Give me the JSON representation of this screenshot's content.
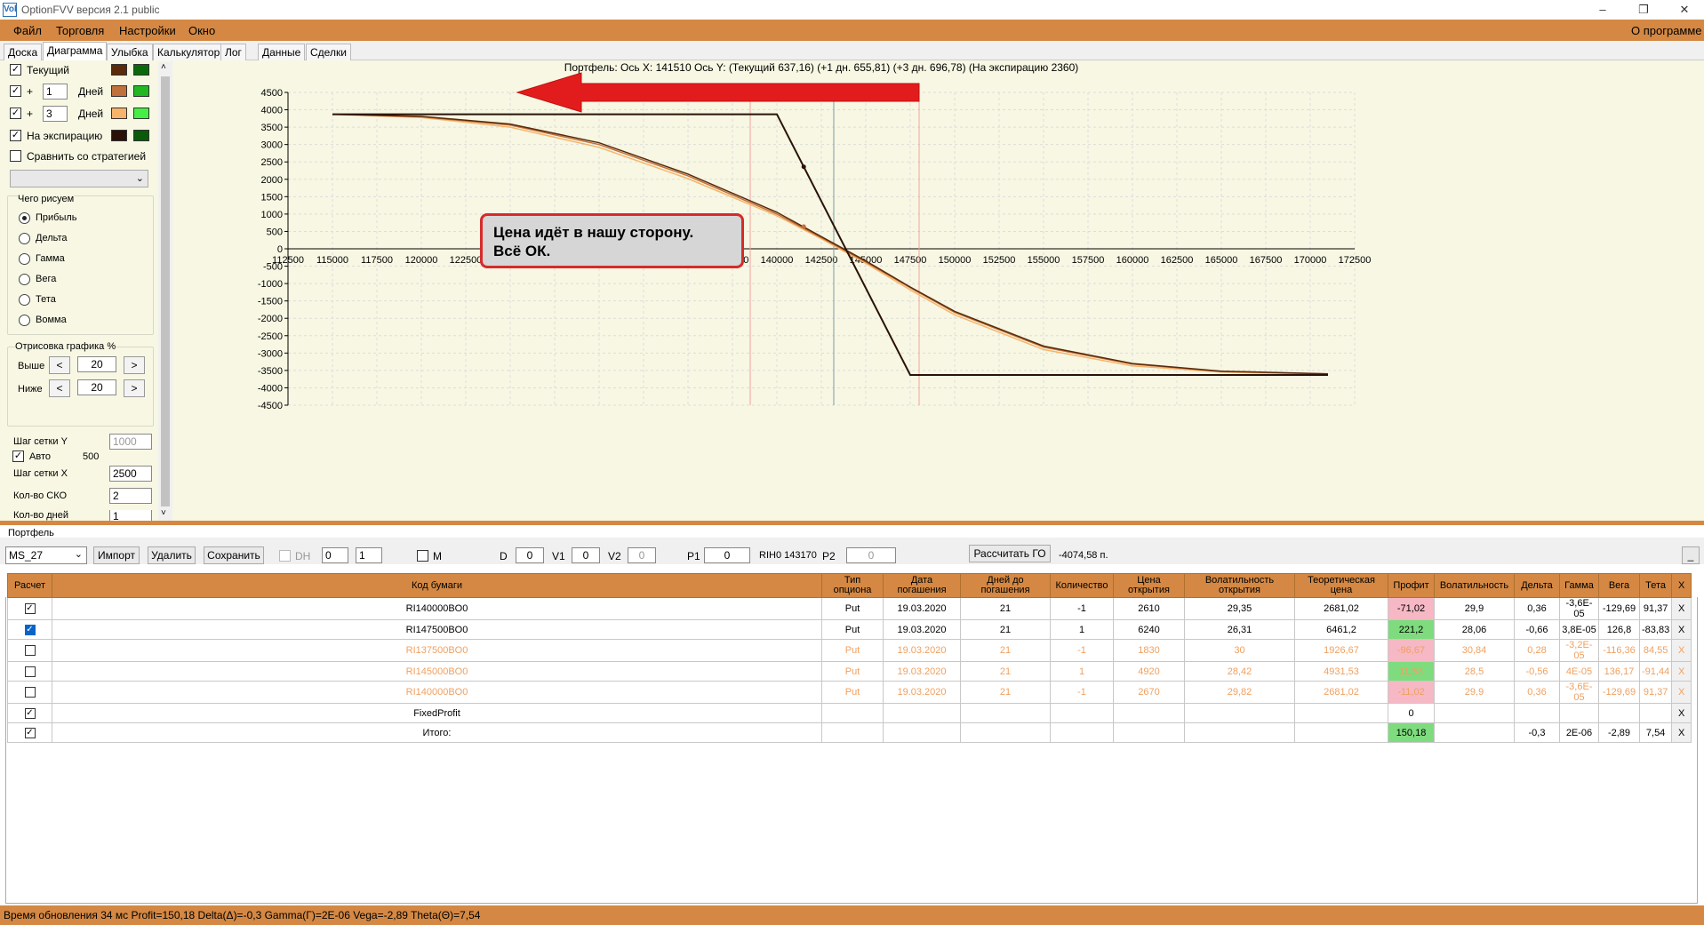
{
  "window": {
    "title": "OptionFVV версия 2.1 public",
    "minimize": "–",
    "restore": "❐",
    "close": "✕"
  },
  "menu": {
    "items": [
      "Файл",
      "Торговля",
      "Настройки",
      "Окно"
    ],
    "about": "О программе"
  },
  "tabs": [
    "Доска",
    "Диаграмма",
    "Улыбка",
    "Калькулятор",
    "Лог",
    "Данные",
    "Сделки"
  ],
  "left": {
    "current_label": "Текущий",
    "plus": "+",
    "days1": "1",
    "days_label": "Дней",
    "days2": "3",
    "expiry_label": "На экспирацию",
    "compare_label": "Сравнить со стратегией",
    "draw_group": "Чего рисуем",
    "draw_options": [
      "Прибыль",
      "Дельта",
      "Гамма",
      "Вега",
      "Тета",
      "Вомма"
    ],
    "render_group": "Отрисовка графика %",
    "above_label": "Выше",
    "above_val": "20",
    "below_label": "Ниже",
    "below_val": "20",
    "prev": "<",
    "next": ">",
    "grid_y_label": "Шаг сетки Y",
    "grid_y_val": "1000",
    "auto_label": "Авто",
    "auto_val": "500",
    "grid_x_label": "Шаг сетки X",
    "grid_x_val": "2500",
    "sko_label": "Кол-во СКО",
    "sko_val": "2",
    "days_count_label": "Кол-во дней",
    "days_count_val": "1",
    "colors": {
      "current": [
        "#5a2a0a",
        "#0a6a0a"
      ],
      "plus1": [
        "#c0703a",
        "#22b822"
      ],
      "plus3": [
        "#f8b46a",
        "#44ee44"
      ],
      "expiry": [
        "#2a1208",
        "#0a5a0a"
      ]
    }
  },
  "chart_data": {
    "type": "line",
    "title": "Портфель: Ось X: 141510 Ось Y:  (Текущий 637,16)  (+1 дн. 655,81)  (+3 дн. 696,78)  (На экспирацию 2360)",
    "xlim": [
      112500,
      172500
    ],
    "ylim": [
      -4500,
      4500
    ],
    "x_ticks": [
      "112500",
      "115000",
      "117500",
      "120000",
      "122500",
      "125000",
      "127500",
      "130000",
      "132500",
      "135000",
      "137500",
      "140000",
      "142500",
      "145000",
      "147500",
      "150000",
      "152500",
      "155000",
      "157500",
      "160000",
      "162500",
      "165000",
      "167500",
      "170000",
      "172500"
    ],
    "y_ticks": [
      "4500",
      "4000",
      "3500",
      "3000",
      "2500",
      "2000",
      "1500",
      "1000",
      "500",
      "0",
      "-500",
      "-1000",
      "-1500",
      "-2000",
      "-2500",
      "-3000",
      "-3500",
      "-4000",
      "-4500"
    ],
    "markers": {
      "current_x": 143200,
      "sko_lines": [
        138500,
        148000
      ]
    },
    "series": [
      {
        "color": "#2a1208",
        "points": [
          [
            115000,
            3870
          ],
          [
            140000,
            3870
          ],
          [
            147500,
            -3630
          ],
          [
            171000,
            -3630
          ]
        ]
      },
      {
        "color": "#5a2a0a",
        "points": [
          [
            115000,
            3870
          ],
          [
            120000,
            3810
          ],
          [
            125000,
            3590
          ],
          [
            130000,
            3050
          ],
          [
            135000,
            2150
          ],
          [
            140000,
            1050
          ],
          [
            142500,
            350
          ],
          [
            145000,
            -350
          ],
          [
            147500,
            -1100
          ],
          [
            150000,
            -1800
          ],
          [
            155000,
            -2800
          ],
          [
            160000,
            -3300
          ],
          [
            165000,
            -3520
          ],
          [
            171000,
            -3600
          ]
        ]
      },
      {
        "color": "#c0703a",
        "points": [
          [
            115000,
            3870
          ],
          [
            120000,
            3800
          ],
          [
            125000,
            3560
          ],
          [
            130000,
            3000
          ],
          [
            135000,
            2100
          ],
          [
            140000,
            1000
          ],
          [
            142500,
            320
          ],
          [
            145000,
            -380
          ],
          [
            147500,
            -1120
          ],
          [
            150000,
            -1830
          ],
          [
            155000,
            -2830
          ],
          [
            160000,
            -3320
          ],
          [
            165000,
            -3530
          ],
          [
            171000,
            -3600
          ]
        ]
      },
      {
        "color": "#f8b46a",
        "points": [
          [
            115000,
            3870
          ],
          [
            120000,
            3780
          ],
          [
            125000,
            3500
          ],
          [
            130000,
            2920
          ],
          [
            135000,
            2020
          ],
          [
            140000,
            950
          ],
          [
            142500,
            290
          ],
          [
            145000,
            -420
          ],
          [
            147500,
            -1180
          ],
          [
            150000,
            -1900
          ],
          [
            155000,
            -2900
          ],
          [
            160000,
            -3370
          ],
          [
            165000,
            -3550
          ],
          [
            171000,
            -3610
          ]
        ]
      }
    ]
  },
  "callout": {
    "line1": "Цена идёт в нашу сторону.",
    "line2": "Всё ОК."
  },
  "portfolio": {
    "label": "Портфель",
    "account": "MS_27",
    "import": "Импорт",
    "delete": "Удалить",
    "save": "Сохранить",
    "dh": "DH",
    "dh_a": "0",
    "dh_b": "1",
    "m": "M",
    "d_label": "D",
    "d_val": "0",
    "v1_label": "V1",
    "v1_val": "0",
    "v2_label": "V2",
    "v2_val": "0",
    "p1_label": "P1",
    "p1_val": "0",
    "ri_info": "RIH0 143170",
    "p2_label": "P2",
    "p2_val": "0",
    "calc_go": "Рассчитать ГО",
    "go_value": "-4074,58 п.",
    "minimize": "_"
  },
  "table": {
    "headers": [
      "Расчет",
      "Код бумаги",
      "Тип опциона",
      "Дата погашения",
      "Дней до погашения",
      "Количество",
      "Цена открытия",
      "Волатильность открытия",
      "Теоретическая цена",
      "Профит",
      "Волатильность",
      "Дельта",
      "Гамма",
      "Вега",
      "Тета",
      "X"
    ],
    "rows": [
      {
        "checked": true,
        "cells": [
          "RI140000BO0",
          "Put",
          "19.03.2020",
          "21",
          "-1",
          "2610",
          "29,35",
          "2681,02",
          "-71,02",
          "29,9",
          "0,36",
          "-3,6E-05",
          "-129,69",
          "91,37",
          "X"
        ],
        "profit_bg": "pink"
      },
      {
        "checked": true,
        "sel": true,
        "cells": [
          "RI147500BO0",
          "Put",
          "19.03.2020",
          "21",
          "1",
          "6240",
          "26,31",
          "6461,2",
          "221,2",
          "28,06",
          "-0,66",
          "3,8E-05",
          "126,8",
          "-83,83",
          "X"
        ],
        "profit_bg": "green"
      },
      {
        "checked": false,
        "dis": true,
        "cells": [
          "RI137500BO0",
          "Put",
          "19.03.2020",
          "21",
          "-1",
          "1830",
          "30",
          "1926,67",
          "-96,67",
          "30,84",
          "0,28",
          "-3,2E-05",
          "-116,36",
          "84,55",
          "X"
        ],
        "profit_bg": "pink"
      },
      {
        "checked": false,
        "dis": true,
        "cells": [
          "RI145000BO0",
          "Put",
          "19.03.2020",
          "21",
          "1",
          "4920",
          "28,42",
          "4931,53",
          "11,53",
          "28,5",
          "-0,56",
          "4E-05",
          "136,17",
          "-91,44",
          "X"
        ],
        "profit_bg": "green"
      },
      {
        "checked": false,
        "dis": true,
        "cells": [
          "RI140000BO0",
          "Put",
          "19.03.2020",
          "21",
          "-1",
          "2670",
          "29,82",
          "2681,02",
          "-11,02",
          "29,9",
          "0,36",
          "-3,6E-05",
          "-129,69",
          "91,37",
          "X"
        ],
        "profit_bg": "pink"
      },
      {
        "checked": true,
        "cells": [
          "FixedProfit",
          "",
          "",
          "",
          "",
          "",
          "",
          "",
          "0",
          "",
          "",
          "",
          "",
          "",
          "X"
        ],
        "profit_bg": ""
      },
      {
        "checked": true,
        "cells": [
          "Итого:",
          "",
          "",
          "",
          "",
          "",
          "",
          "",
          "150,18",
          "",
          "-0,3",
          "2E-06",
          "-2,89",
          "7,54",
          "X"
        ],
        "profit_bg": "green"
      }
    ]
  },
  "status": "Время обновления 34 мс  Profit=150,18 Delta(Δ)=-0,3 Gamma(Γ)=2E-06 Vega=-2,89 Theta(Θ)=7,54"
}
